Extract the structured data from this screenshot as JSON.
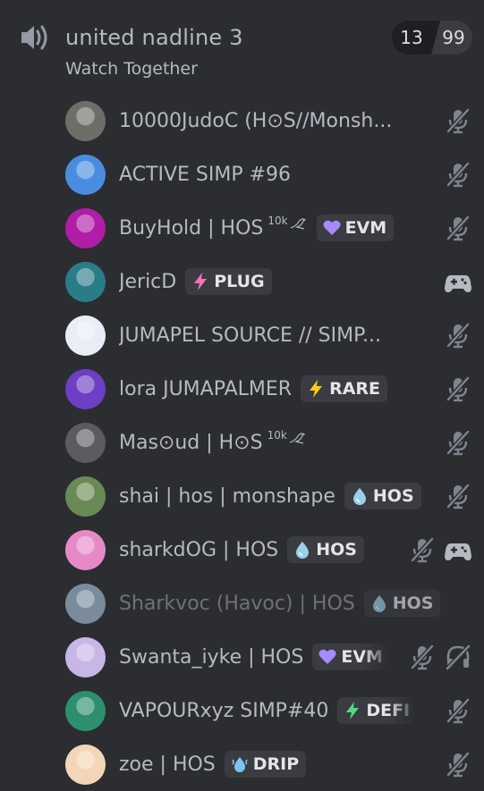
{
  "channel": {
    "name": "united nadline 3",
    "activity": "Watch Together",
    "user_count": "13",
    "user_limit": "99"
  },
  "users": [
    {
      "name": "10000JudoC (H⊙S//Monsh...",
      "tag": null,
      "icons": [
        "mic-muted"
      ],
      "avatar_color": "#6b6f67"
    },
    {
      "name": "ACTIVE SIMP #96",
      "tag": null,
      "icons": [
        "mic-muted"
      ],
      "avatar_color": "#4a8de0"
    },
    {
      "name": "BuyHold | HOS",
      "suffix": "10k",
      "tag": {
        "label": "EVM",
        "icon": "purple-heart-icon",
        "color": "#a78bfa"
      },
      "icons": [
        "mic-muted"
      ],
      "avatar_color": "#b01da6"
    },
    {
      "name": "JericD",
      "tag": {
        "label": "PLUG",
        "icon": "pink-lightning-icon",
        "color": "#f472b6"
      },
      "icons": [
        "gamepad"
      ],
      "avatar_color": "#2a7c88"
    },
    {
      "name": "JUMAPEL SOURCE // SIMP...",
      "tag": null,
      "icons": [
        "mic-muted"
      ],
      "avatar_color": "#e9eef6"
    },
    {
      "name": "lora JUMAPALMER",
      "tag": {
        "label": "RARE",
        "icon": "yellow-lightning-icon",
        "color": "#facc15"
      },
      "icons": [
        "mic-muted"
      ],
      "avatar_color": "#6c3fc4"
    },
    {
      "name": "Mas⊙ud | H⊙S",
      "suffix": "10k",
      "tag": null,
      "icons": [
        "mic-muted"
      ],
      "avatar_color": "#5a5c61"
    },
    {
      "name": "shai | hos | monshape",
      "tag": {
        "label": "HOS",
        "icon": "blue-drop-icon",
        "color": "#9ad1e8"
      },
      "icons": [
        "mic-muted"
      ],
      "avatar_color": "#6a8a55"
    },
    {
      "name": "sharkdOG | HOS",
      "tag": {
        "label": "HOS",
        "icon": "blue-drop-icon",
        "color": "#9ad1e8"
      },
      "icons": [
        "mic-muted",
        "gamepad"
      ],
      "avatar_color": "#e58ac7"
    },
    {
      "name": "Sharkvoc (Havoc) | HOS",
      "tag": {
        "label": "HOS",
        "icon": "blue-drop-icon",
        "color": "#9ad1e8"
      },
      "icons": [],
      "dim": true,
      "avatar_color": "#7a8c9c"
    },
    {
      "name": "Swanta_iyke | HOS",
      "tag": {
        "label": "EVM",
        "icon": "purple-heart-icon",
        "color": "#a78bfa",
        "fade": true
      },
      "icons": [
        "mic-muted",
        "headphones-deafened"
      ],
      "avatar_color": "#c7b6e6"
    },
    {
      "name": "VAPOURxyz SIMP#40",
      "tag": {
        "label": "DEFI",
        "icon": "green-lightning-icon",
        "color": "#4ade80",
        "fade": true
      },
      "icons": [
        "mic-muted"
      ],
      "avatar_color": "#2e8f6e"
    },
    {
      "name": "zoe | HOS",
      "tag": {
        "label": "DRIP",
        "icon": "blue-splash-icon",
        "color": "#7cc4f0"
      },
      "icons": [
        "mic-muted"
      ],
      "avatar_color": "#f3d6b8"
    }
  ]
}
